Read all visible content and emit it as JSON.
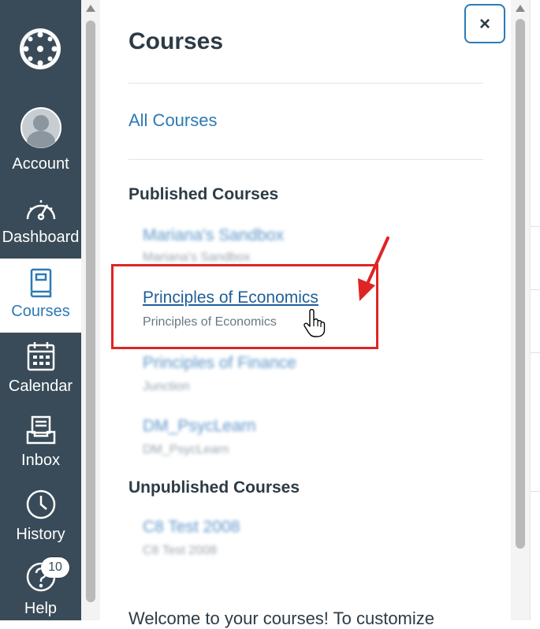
{
  "global_nav": {
    "items": [
      {
        "key": "account",
        "label": "Account",
        "icon": "avatar-icon"
      },
      {
        "key": "dashboard",
        "label": "Dashboard",
        "icon": "speedometer-icon"
      },
      {
        "key": "courses",
        "label": "Courses",
        "icon": "book-icon",
        "active": true
      },
      {
        "key": "calendar",
        "label": "Calendar",
        "icon": "calendar-icon"
      },
      {
        "key": "inbox",
        "label": "Inbox",
        "icon": "inbox-icon"
      },
      {
        "key": "history",
        "label": "History",
        "icon": "clock-icon"
      },
      {
        "key": "help",
        "label": "Help",
        "icon": "help-icon"
      }
    ],
    "help_badge": "10"
  },
  "tray": {
    "title": "Courses",
    "close_label": "×",
    "all_courses": "All Courses",
    "published_heading": "Published Courses",
    "published": [
      {
        "name": "Mariana's Sandbox",
        "sub": "Mariana's Sandbox",
        "blurred": true
      },
      {
        "name": "Principles of Economics",
        "sub": "Principles of Economics",
        "blurred": false
      },
      {
        "name": "Principles of Finance",
        "sub": "Junction",
        "blurred": true
      },
      {
        "name": "DM_PsycLearn",
        "sub": "DM_PsycLearn",
        "blurred": true
      }
    ],
    "unpublished_heading": "Unpublished Courses",
    "unpublished": [
      {
        "name": "C8 Test 2008",
        "sub": "C8 Test 2008",
        "blurred": true
      }
    ],
    "welcome_text": "Welcome to your courses! To customize"
  },
  "colors": {
    "nav_bg": "#394b58",
    "link": "#2d7ab6",
    "annotation_red": "#e02424"
  }
}
